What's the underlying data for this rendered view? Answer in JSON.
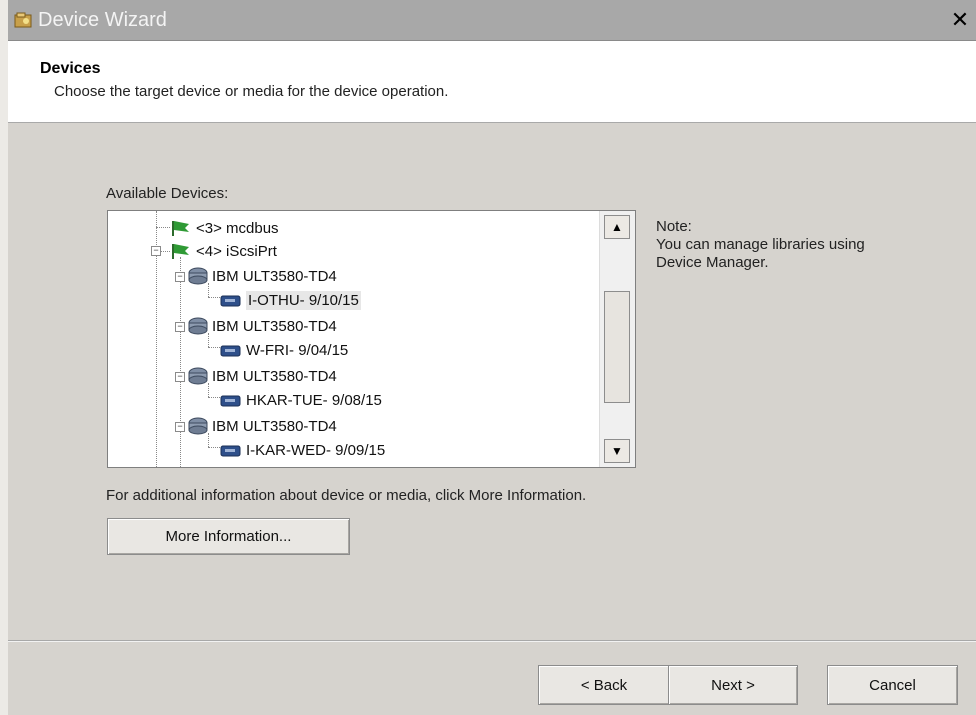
{
  "window": {
    "title": "Device Wizard",
    "close_glyph": "✕",
    "icon": "wizard-icon"
  },
  "header": {
    "title": "Devices",
    "subtitle": "Choose the target device or media for the device operation."
  },
  "devices": {
    "label": "Available Devices:",
    "tree": [
      {
        "text": "<3> mcdbus",
        "icon": "green-flag-icon"
      },
      {
        "text": "<4> iScsiPrt",
        "icon": "green-flag-icon"
      },
      {
        "text": "IBM    ULT3580-TD4",
        "icon": "tape-drive-icon"
      },
      {
        "text": "I-OTHU- 9/10/15",
        "icon": "tape-media-icon",
        "selected": true
      },
      {
        "text": "IBM    ULT3580-TD4",
        "icon": "tape-drive-icon"
      },
      {
        "text": "W-FRI- 9/04/15",
        "icon": "tape-media-icon"
      },
      {
        "text": "IBM    ULT3580-TD4",
        "icon": "tape-drive-icon"
      },
      {
        "text": "HKAR-TUE- 9/08/15",
        "icon": "tape-media-icon"
      },
      {
        "text": "IBM    ULT3580-TD4",
        "icon": "tape-drive-icon"
      },
      {
        "text": "I-KAR-WED- 9/09/15",
        "icon": "tape-media-icon"
      }
    ],
    "scroll_up": "▲",
    "scroll_down": "▼"
  },
  "note": {
    "line1": "Note:",
    "line2": "You can manage libraries using",
    "line3": "Device Manager."
  },
  "info": {
    "text": "For additional information about device or media, click More Information.",
    "more_button": "More Information..."
  },
  "footer": {
    "back": "< Back",
    "next": "Next >",
    "cancel": "Cancel"
  }
}
